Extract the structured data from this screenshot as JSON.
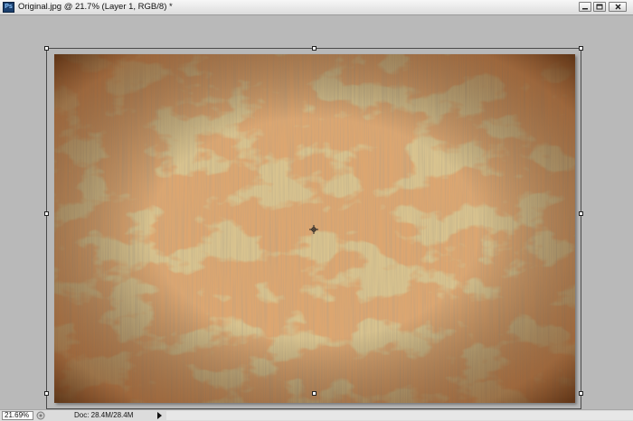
{
  "window": {
    "app_icon_label": "Ps",
    "title": "Original.jpg @ 21.7% (Layer 1, RGB/8) *",
    "buttons": {
      "minimize": "minimize-icon",
      "restore": "restore-icon",
      "close": "close-icon"
    }
  },
  "canvas": {
    "background_color": "#b9b9b9",
    "image_colors": {
      "base": "#dcc690",
      "light": "#efe2b9",
      "rust": "#b8612a",
      "dark_rust": "#8a4a1e"
    }
  },
  "status": {
    "zoom": "21.69%",
    "doc": "Doc: 28.4M/28.4M"
  }
}
